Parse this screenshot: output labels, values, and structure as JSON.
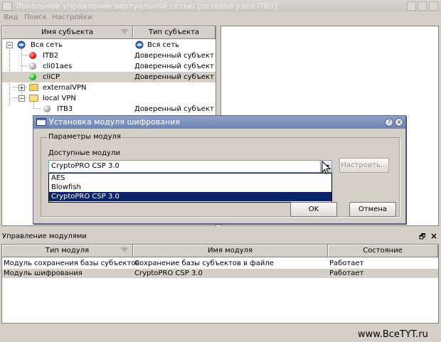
{
  "window": {
    "title": "Локальное управление виртуальной сетью [сетевой узел ITB3]"
  },
  "menu": {
    "items": [
      "Вид",
      "Поиск",
      "Настройки"
    ]
  },
  "tree": {
    "col_name": "Имя субъекта",
    "col_type": "Тип субъекта",
    "rows": [
      {
        "name": "Вся сеть",
        "type": "Вся сеть"
      },
      {
        "name": "ITB2",
        "type": "Доверенный субъект"
      },
      {
        "name": "cli01aes",
        "type": "Доверенный субъект"
      },
      {
        "name": "cliCP",
        "type": "Доверенный субъект"
      },
      {
        "name": "externalVPN",
        "type": ""
      },
      {
        "name": "local VPN",
        "type": ""
      },
      {
        "name": "ITB3",
        "type": "Доверенный субъект"
      }
    ]
  },
  "modules": {
    "title": "Управление модулями",
    "col_type": "Тип модуля",
    "col_name": "Имя модуля",
    "col_state": "Состояние",
    "rows": [
      {
        "type": "Модуль сохранения базы субъектов",
        "name": "Сохранение базы субъектов в файле",
        "state": "Работает"
      },
      {
        "type": "Модуль шифрования",
        "name": "CryptoPRO CSP 3.0",
        "state": "Работает"
      }
    ]
  },
  "dialog": {
    "title": "Установка модуля шифрования",
    "group_title": "Параметры модуля",
    "available_label": "Доступные модули",
    "combo_value": "CryptoPRO CSP 3.0",
    "options": [
      "AES",
      "Blowfish",
      "CryptoPRO CSP 3.0"
    ],
    "selected_option": "CryptoPRO CSP 3.0",
    "configure_label": "Настроить...",
    "ok_label": "OK",
    "cancel_label": "Отмена",
    "help_glyph": "?",
    "close_glyph": "×"
  },
  "dock": {
    "float_glyph": "🗗",
    "close_glyph": "×"
  },
  "watermark": "www.BceTYT.ru"
}
